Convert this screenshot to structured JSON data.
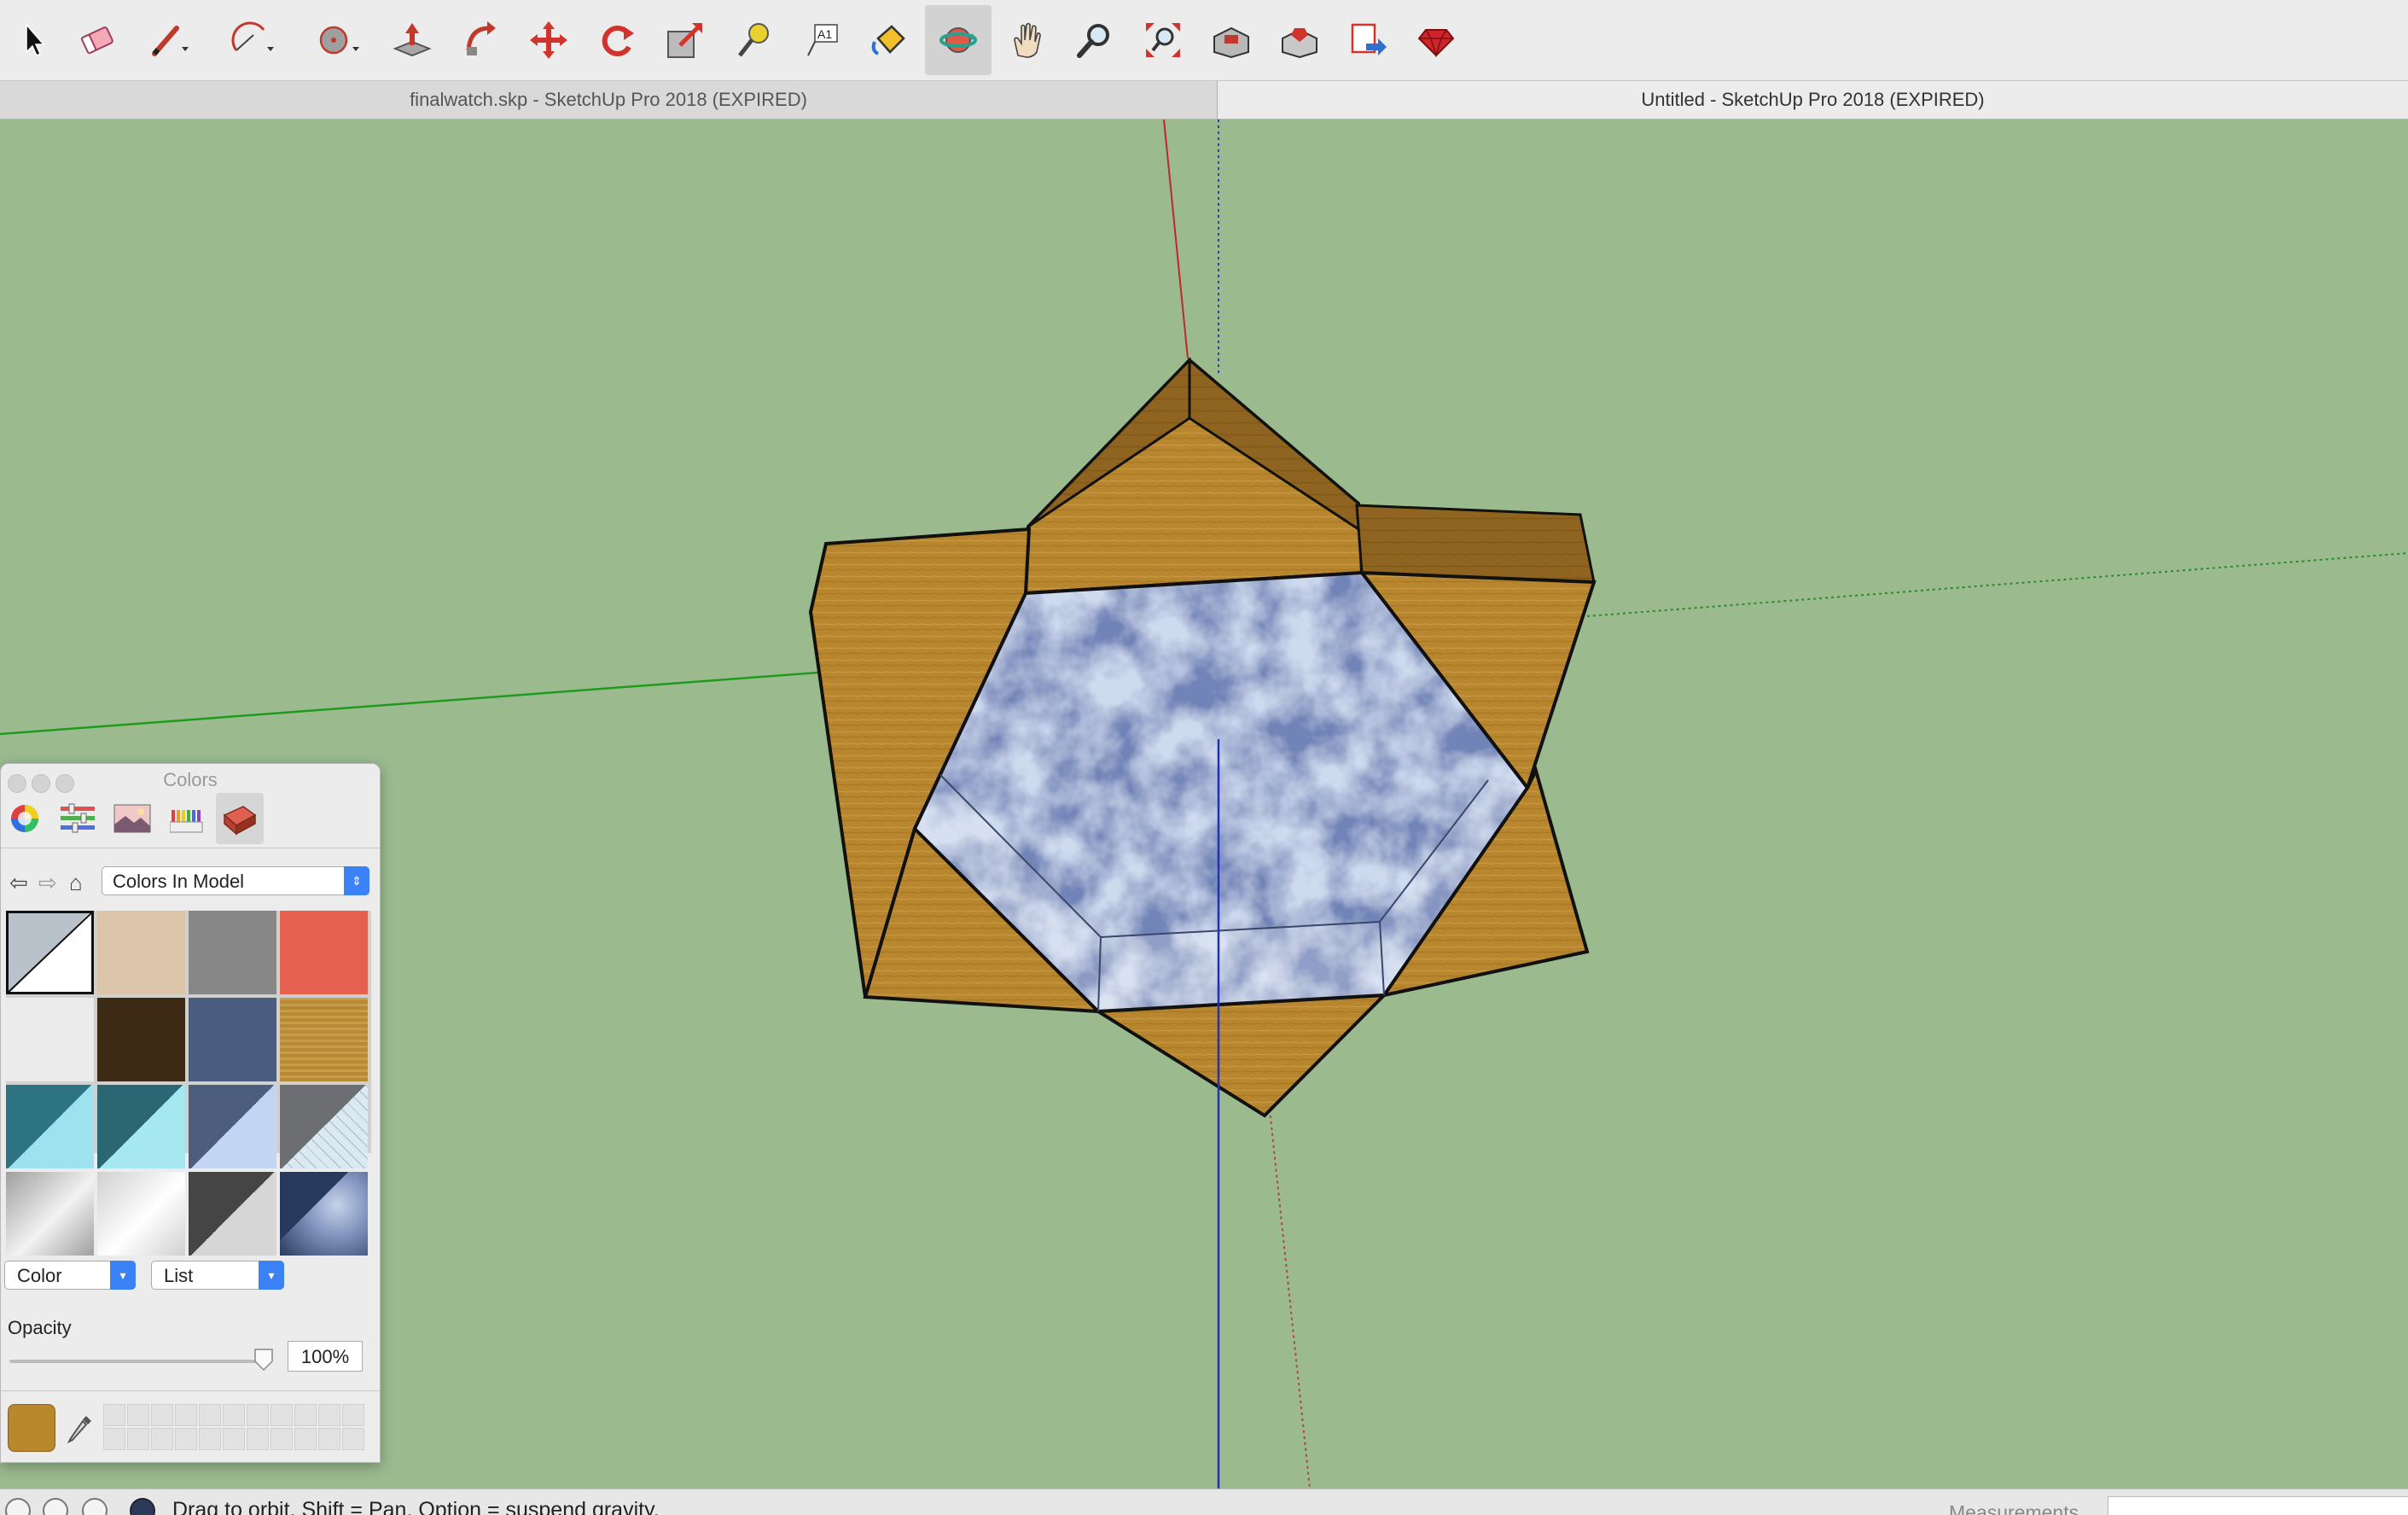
{
  "toolbar": {
    "tools": [
      {
        "name": "select-icon",
        "label": "Select"
      },
      {
        "name": "eraser-icon",
        "label": "Eraser"
      },
      {
        "name": "pencil-icon",
        "label": "Line"
      },
      {
        "name": "arc-icon",
        "label": "Arc"
      },
      {
        "name": "shape-icon",
        "label": "Shapes"
      },
      {
        "name": "push-pull-icon",
        "label": "Push/Pull"
      },
      {
        "name": "follow-me-icon",
        "label": "Follow Me"
      },
      {
        "name": "move-icon",
        "label": "Move"
      },
      {
        "name": "rotate-icon",
        "label": "Rotate"
      },
      {
        "name": "scale-icon",
        "label": "Scale"
      },
      {
        "name": "tape-measure-icon",
        "label": "Tape Measure"
      },
      {
        "name": "text-icon",
        "label": "Text",
        "glyph": "A1"
      },
      {
        "name": "paint-bucket-icon",
        "label": "Paint Bucket"
      },
      {
        "name": "orbit-icon",
        "label": "Orbit",
        "active": true
      },
      {
        "name": "pan-icon",
        "label": "Pan"
      },
      {
        "name": "zoom-icon",
        "label": "Zoom"
      },
      {
        "name": "zoom-extents-icon",
        "label": "Zoom Extents"
      },
      {
        "name": "warehouse-icon",
        "label": "3D Warehouse"
      },
      {
        "name": "extension-warehouse-icon",
        "label": "Extension Warehouse"
      },
      {
        "name": "send-to-layout-icon",
        "label": "Send to LayOut"
      },
      {
        "name": "ruby-console-icon",
        "label": "Ruby Console"
      }
    ]
  },
  "tabs": [
    {
      "title": "finalwatch.skp - SketchUp Pro 2018 (EXPIRED)"
    },
    {
      "title": "Untitled - SketchUp Pro 2018 (EXPIRED)"
    }
  ],
  "colors_panel": {
    "title": "Colors",
    "modes": [
      "color-wheel-icon",
      "color-sliders-icon",
      "image-palette-icon",
      "crayons-icon",
      "materials-icon"
    ],
    "active_mode": "materials-icon",
    "palette": "Colors In Model",
    "swatches": [
      {
        "name": "default-material",
        "type": "split",
        "c1": "#b9c2cb",
        "c2": "#ffffff",
        "selected": true
      },
      {
        "name": "tan",
        "type": "solid",
        "c1": "#dcc5a8"
      },
      {
        "name": "gray",
        "type": "solid",
        "c1": "#878787"
      },
      {
        "name": "coral",
        "type": "solid",
        "c1": "#e5604f"
      },
      {
        "name": "off-white",
        "type": "solid",
        "c1": "#ebebeb"
      },
      {
        "name": "dark-brown",
        "type": "solid",
        "c1": "#3d2a14"
      },
      {
        "name": "slate-blue",
        "type": "solid",
        "c1": "#4b5c81"
      },
      {
        "name": "wood",
        "type": "wood",
        "c1": "#b68a36",
        "c2": "#c99d48"
      },
      {
        "name": "teal-glass",
        "type": "split",
        "c1": "#2e7381",
        "c2": "#9ee2ef"
      },
      {
        "name": "teal-glass-2",
        "type": "split",
        "c1": "#2a6772",
        "c2": "#a6e8f2"
      },
      {
        "name": "blue-glass",
        "type": "split",
        "c1": "#4c5d7e",
        "c2": "#c2d6f4"
      },
      {
        "name": "metal-mesh",
        "type": "mesh",
        "c1": "#6c6e72",
        "c2": "#dbe9f2"
      },
      {
        "name": "silver",
        "type": "gradient",
        "c1": "#9f9f9f",
        "c2": "#f2f2f2"
      },
      {
        "name": "chrome",
        "type": "gradient",
        "c1": "#d0d0d0",
        "c2": "#ffffff"
      },
      {
        "name": "charcoal",
        "type": "split",
        "c1": "#454545",
        "c2": "#d6d6d6"
      },
      {
        "name": "sky",
        "type": "sky",
        "c1": "#273a5e",
        "c2": "#c7d3ea"
      }
    ],
    "color_dropdown": "Color",
    "view_dropdown": "List",
    "opacity_label": "Opacity",
    "opacity": "100%",
    "current_color": "#b9872c"
  },
  "statusbar": {
    "hint": "Drag to orbit. Shift = Pan, Option = suspend gravity.",
    "measurements_label": "Measurements",
    "measurements_value": ""
  },
  "colors": {
    "background": "#9bbb8f",
    "wood": "#b8862e",
    "sky": "#a9bad8"
  }
}
